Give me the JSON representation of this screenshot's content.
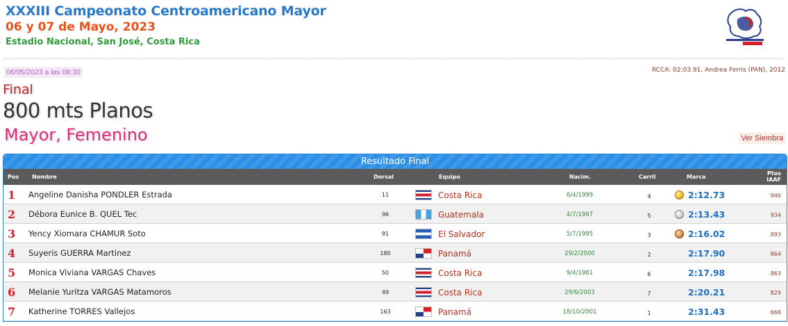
{
  "header": {
    "title": "XXXIII Campeonato Centroamericano Mayor",
    "dates": "06 y 07 de Mayo, 2023",
    "venue": "Estadio Nacional, San José, Costa Rica",
    "logo_icon": "championship-logo"
  },
  "event": {
    "timestamp": "06/05/2023 a las 08:30",
    "record": "RCCA: 02:03.91, Andrea Ferris (PAN), 2012",
    "round": "Final",
    "name": "800 mts Planos",
    "category": "Mayor, Femenino",
    "series_link": "Ver Siembra"
  },
  "table": {
    "banner": "Resultado Final",
    "columns": {
      "pos": "Pos",
      "name": "Nombre",
      "dorsal": "Dorsal",
      "team": "Equipo",
      "birth": "Nacim.",
      "lane": "Carril",
      "mark": "Marca",
      "pts_line1": "Ptos",
      "pts_line2": "IAAF"
    },
    "rows": [
      {
        "pos": "1",
        "name": "Angeline Danisha PONDLER Estrada",
        "dorsal": "11",
        "flag": "cr",
        "team": "Costa Rica",
        "birth": "6/4/1999",
        "lane": "4",
        "medal": "gold",
        "mark": "2:12.73",
        "pts": "946"
      },
      {
        "pos": "2",
        "name": "Débora Eunice B. QUEL Tec",
        "dorsal": "96",
        "flag": "gt",
        "team": "Guatemala",
        "birth": "4/7/1997",
        "lane": "5",
        "medal": "silver",
        "mark": "2:13.43",
        "pts": "934"
      },
      {
        "pos": "3",
        "name": "Yency Xiomara CHAMUR Soto",
        "dorsal": "91",
        "flag": "sv",
        "team": "El Salvador",
        "birth": "5/7/1995",
        "lane": "3",
        "medal": "bronze",
        "mark": "2:16.02",
        "pts": "893"
      },
      {
        "pos": "4",
        "name": "Suyeris GUERRA Martinez",
        "dorsal": "180",
        "flag": "pa",
        "team": "Panamá",
        "birth": "29/2/2000",
        "lane": "2",
        "medal": "none",
        "mark": "2:17.90",
        "pts": "864"
      },
      {
        "pos": "5",
        "name": "Monica Viviana VARGAS Chaves",
        "dorsal": "50",
        "flag": "cr",
        "team": "Costa Rica",
        "birth": "9/4/1981",
        "lane": "6",
        "medal": "none",
        "mark": "2:17.98",
        "pts": "863"
      },
      {
        "pos": "6",
        "name": "Melanie Yuritza VARGAS Matamoros",
        "dorsal": "49",
        "flag": "cr",
        "team": "Costa Rica",
        "birth": "29/6/2003",
        "lane": "7",
        "medal": "none",
        "mark": "2:20.21",
        "pts": "829"
      },
      {
        "pos": "7",
        "name": "Katherine TORRES Vallejos",
        "dorsal": "163",
        "flag": "pa",
        "team": "Panamá",
        "birth": "18/10/2001",
        "lane": "1",
        "medal": "none",
        "mark": "2:31.43",
        "pts": "668"
      }
    ]
  }
}
